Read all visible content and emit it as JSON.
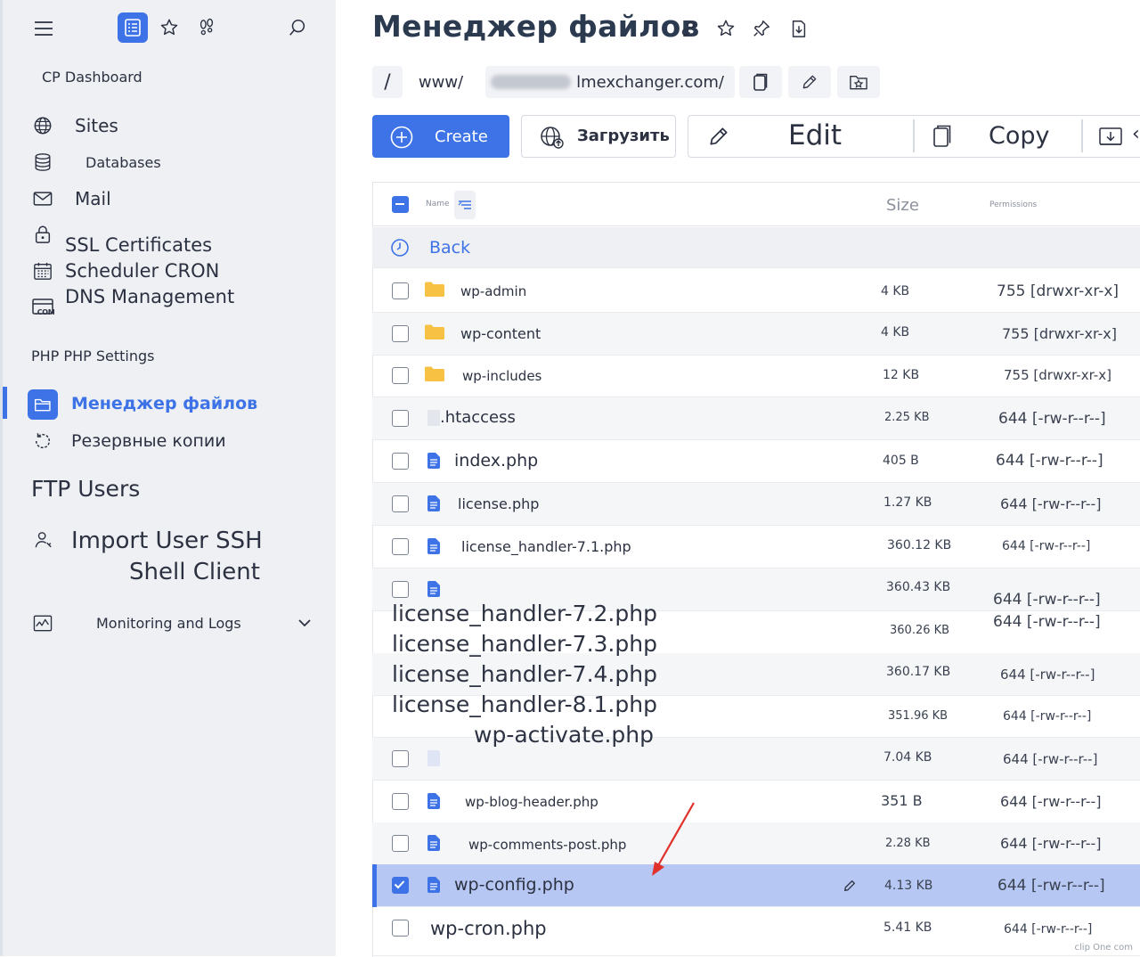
{
  "sidebar": {
    "dashboard": "CP Dashboard",
    "items": [
      {
        "label": "Sites"
      },
      {
        "label": "Databases"
      },
      {
        "label": "Mail"
      },
      {
        "label": "SSL Certificates"
      },
      {
        "label": "Scheduler CRON"
      },
      {
        "label": "DNS Management"
      },
      {
        "label": "PHP PHP Settings"
      },
      {
        "label": "Менеджер файлов"
      },
      {
        "label": "Резервные копии"
      },
      {
        "label": "FTP Users"
      },
      {
        "label": "Import User SSH"
      },
      {
        "label": "Shell Client"
      },
      {
        "label": "Monitoring and Logs"
      }
    ],
    "com_badge": ".COM"
  },
  "page": {
    "title": "Менеджер файлов"
  },
  "path": {
    "root": "/",
    "dir": "www/",
    "domain": "lmexchanger.com/"
  },
  "toolbar": {
    "create": "Create",
    "upload": "Загрузить",
    "edit": "Edit",
    "copy": "Copy"
  },
  "table": {
    "col_name": "Name",
    "col_size": "Size",
    "col_permissions": "Permissions",
    "back": "Back",
    "rows": [
      {
        "name": "wp-admin",
        "size": "4 KB",
        "perm": "755 [drwxr-xr-x]",
        "type": "folder"
      },
      {
        "name": "wp-content",
        "size": "4 KB",
        "perm": "755 [drwxr-xr-x]",
        "type": "folder"
      },
      {
        "name": "wp-includes",
        "size": "12 KB",
        "perm": "755 [drwxr-xr-x]",
        "type": "folder"
      },
      {
        "name": ".htaccess",
        "size": "2.25 KB",
        "perm": "644 [-rw-r--r--]",
        "type": "file-plain"
      },
      {
        "name": "index.php",
        "size": "405 B",
        "perm": "644 [-rw-r--r--]",
        "type": "file"
      },
      {
        "name": "license.php",
        "size": "1.27 KB",
        "perm": "644 [-rw-r--r--]",
        "type": "file"
      },
      {
        "name": "license_handler-7.1.php",
        "size": "360.12 KB",
        "perm": "644 [-rw-r--r--]",
        "type": "file"
      },
      {
        "name": "",
        "size": "360.43 KB",
        "perm": "644 [-rw-r--r--]",
        "type": "file"
      },
      {
        "name": "",
        "size": "360.26 KB",
        "perm": "644 [-rw-r--r--]",
        "type": "file"
      },
      {
        "name": "",
        "size": "360.17 KB",
        "perm": "644 [-rw-r--r--]",
        "type": "file"
      },
      {
        "name": "",
        "size": "351.96 KB",
        "perm": "644 [-rw-r--r--]",
        "type": "file"
      },
      {
        "name": "",
        "size": "7.04 KB",
        "perm": "644 [-rw-r--r--]",
        "type": "file-plain"
      },
      {
        "name": "wp-blog-header.php",
        "size": "351 B",
        "perm": "644 [-rw-r--r--]",
        "type": "file"
      },
      {
        "name": "wp-comments-post.php",
        "size": "2.28 KB",
        "perm": "644 [-rw-r--r--]",
        "type": "file"
      },
      {
        "name": "wp-config.php",
        "size": "4.13 KB",
        "perm": "644 [-rw-r--r--]",
        "type": "file",
        "selected": true
      },
      {
        "name": "wp-cron.php",
        "size": "5.41 KB",
        "perm": "644 [-rw-r--r--]",
        "type": "file"
      }
    ],
    "overlay_names": [
      "license_handler-7.2.php",
      "license_handler-7.3.php",
      "license_handler-7.4.php",
      "license_handler-8.1.php",
      "wp-activate.php"
    ]
  },
  "watermark": "clip One com",
  "colors": {
    "accent": "#3d73e6",
    "selected_row": "#b7c7f3",
    "sidebar_bg": "#eef0f4",
    "folder": "#f7c244",
    "arrow": "#e0312b"
  }
}
